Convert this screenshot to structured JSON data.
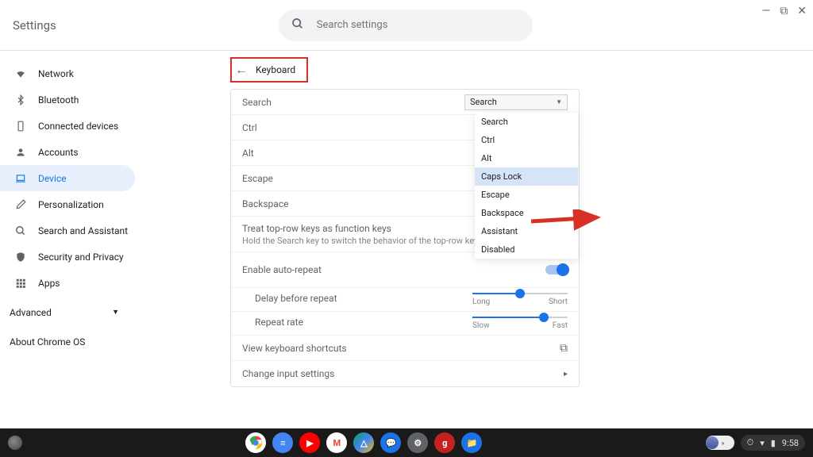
{
  "header": {
    "app_title": "Settings",
    "search_placeholder": "Search settings"
  },
  "sidebar": {
    "items": [
      {
        "label": "Network"
      },
      {
        "label": "Bluetooth"
      },
      {
        "label": "Connected devices"
      },
      {
        "label": "Accounts"
      },
      {
        "label": "Device"
      },
      {
        "label": "Personalization"
      },
      {
        "label": "Search and Assistant"
      },
      {
        "label": "Security and Privacy"
      },
      {
        "label": "Apps"
      }
    ],
    "advanced_label": "Advanced",
    "about_label": "About Chrome OS"
  },
  "page": {
    "title": "Keyboard",
    "rows": {
      "search": "Search",
      "ctrl": "Ctrl",
      "alt": "Alt",
      "escape": "Escape",
      "backspace": "Backspace"
    },
    "select_value": "Search",
    "dropdown": [
      {
        "label": "Search"
      },
      {
        "label": "Ctrl"
      },
      {
        "label": "Alt"
      },
      {
        "label": "Caps Lock"
      },
      {
        "label": "Escape"
      },
      {
        "label": "Backspace"
      },
      {
        "label": "Assistant"
      },
      {
        "label": "Disabled"
      }
    ],
    "function_keys": {
      "title": "Treat top-row keys as function keys",
      "subtitle": "Hold the Search key to switch the behavior of the top-row keys"
    },
    "auto_repeat_label": "Enable auto-repeat",
    "delay": {
      "label": "Delay before repeat",
      "min": "Long",
      "max": "Short"
    },
    "rate": {
      "label": "Repeat rate",
      "min": "Slow",
      "max": "Fast"
    },
    "shortcuts_label": "View keyboard shortcuts",
    "input_label": "Change input settings"
  },
  "shelf": {
    "time": "9:58"
  }
}
